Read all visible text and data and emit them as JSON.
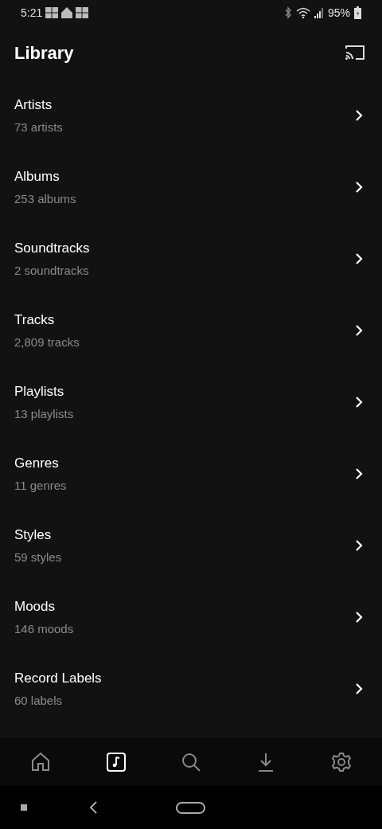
{
  "status_bar": {
    "time": "5:21",
    "battery": "95%"
  },
  "header": {
    "title": "Library"
  },
  "items": [
    {
      "title": "Artists",
      "subtitle": "73 artists"
    },
    {
      "title": "Albums",
      "subtitle": "253 albums"
    },
    {
      "title": "Soundtracks",
      "subtitle": "2 soundtracks"
    },
    {
      "title": "Tracks",
      "subtitle": "2,809 tracks"
    },
    {
      "title": "Playlists",
      "subtitle": "13 playlists"
    },
    {
      "title": "Genres",
      "subtitle": "11 genres"
    },
    {
      "title": "Styles",
      "subtitle": "59 styles"
    },
    {
      "title": "Moods",
      "subtitle": "146 moods"
    },
    {
      "title": "Record Labels",
      "subtitle": "60 labels"
    }
  ],
  "bottom_nav": [
    {
      "kind": "home",
      "selected": false
    },
    {
      "kind": "library",
      "selected": true
    },
    {
      "kind": "search",
      "selected": false
    },
    {
      "kind": "downloads",
      "selected": false
    },
    {
      "kind": "settings",
      "selected": false
    }
  ]
}
